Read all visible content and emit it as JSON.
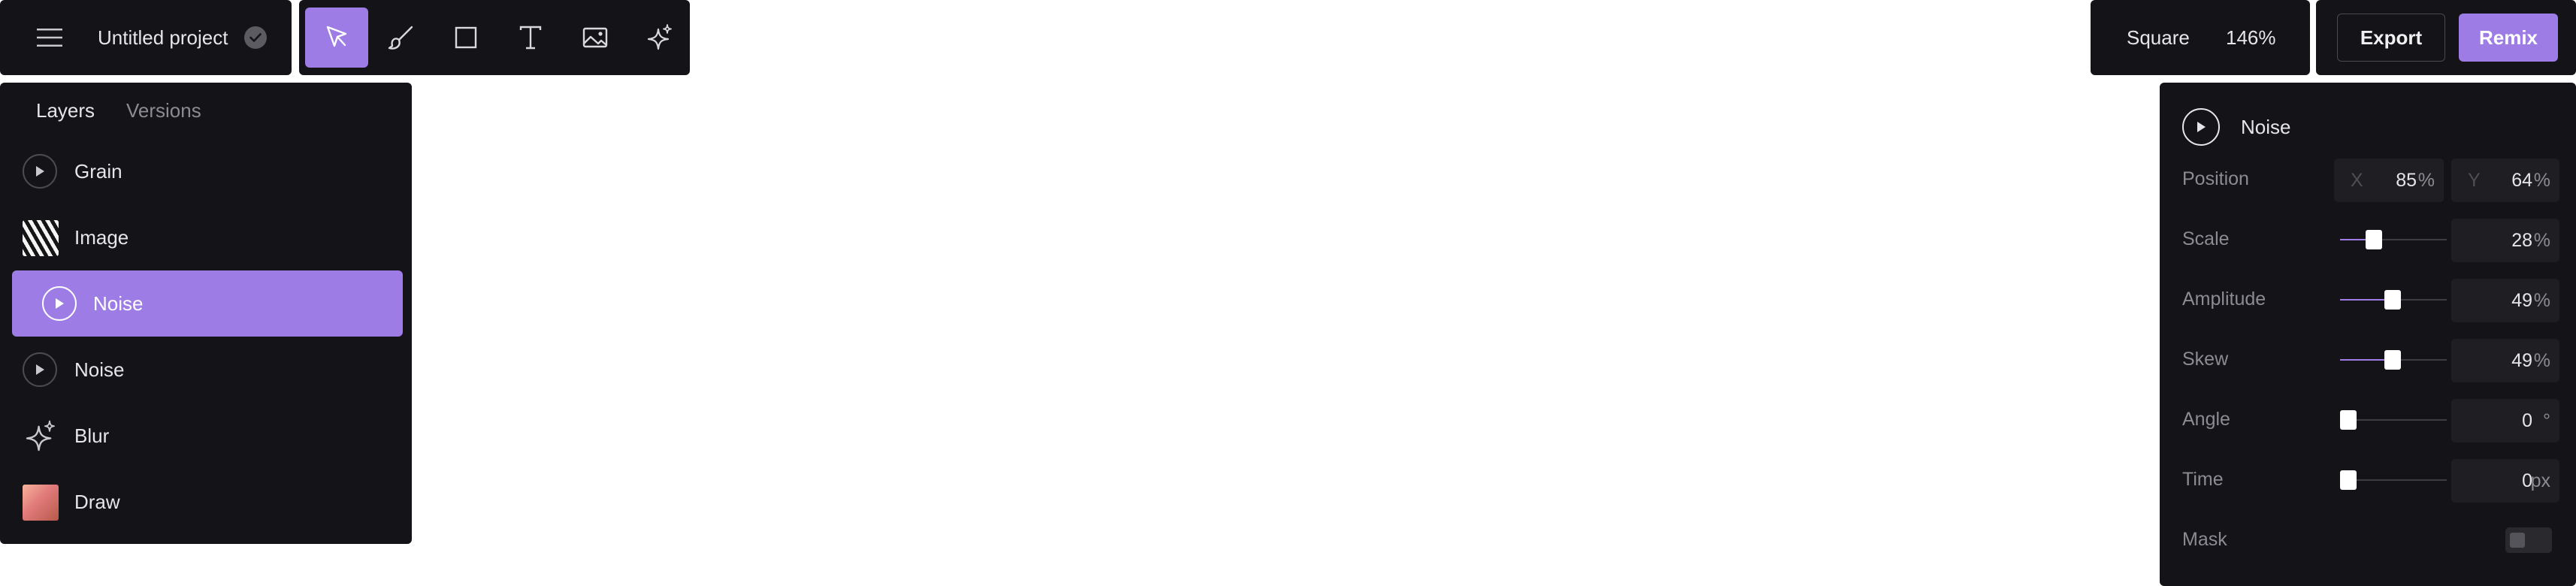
{
  "header": {
    "project_name": "Untitled project",
    "shape": "Square",
    "zoom": "146%",
    "export_label": "Export",
    "remix_label": "Remix"
  },
  "toolbar": {
    "tools": [
      {
        "name": "select",
        "icon": "cursor-arrow-icon",
        "active": true
      },
      {
        "name": "brush",
        "icon": "brush-icon",
        "active": false
      },
      {
        "name": "rectangle",
        "icon": "square-icon",
        "active": false
      },
      {
        "name": "text",
        "icon": "text-icon",
        "active": false
      },
      {
        "name": "image",
        "icon": "image-icon",
        "active": false
      },
      {
        "name": "effects",
        "icon": "sparkle-icon",
        "active": false
      }
    ]
  },
  "layers_panel": {
    "tabs": [
      {
        "label": "Layers",
        "active": true
      },
      {
        "label": "Versions",
        "active": false
      }
    ],
    "layers": [
      {
        "label": "Grain",
        "icon": "play-icon",
        "selected": false
      },
      {
        "label": "Image",
        "icon": "image-thumbnail",
        "selected": false
      },
      {
        "label": "Noise",
        "icon": "play-icon",
        "selected": true
      },
      {
        "label": "Noise",
        "icon": "play-icon",
        "selected": false
      },
      {
        "label": "Blur",
        "icon": "sparkle-icon",
        "selected": false
      },
      {
        "label": "Draw",
        "icon": "gradient-thumbnail",
        "selected": false
      }
    ]
  },
  "properties": {
    "title": "Noise",
    "position": {
      "label": "Position",
      "x_label": "X",
      "x_value": "85",
      "x_unit": "%",
      "y_label": "Y",
      "y_value": "64",
      "y_unit": "%"
    },
    "scale": {
      "label": "Scale",
      "value": "28",
      "unit": "%",
      "slider_fraction": 0.28
    },
    "amplitude": {
      "label": "Amplitude",
      "value": "49",
      "unit": "%",
      "slider_fraction": 0.49
    },
    "skew": {
      "label": "Skew",
      "value": "49",
      "unit": "%",
      "slider_fraction": 0.49
    },
    "angle": {
      "label": "Angle",
      "value": "0",
      "unit": "°",
      "slider_fraction": 0
    },
    "time": {
      "label": "Time",
      "value": "0",
      "unit": "px",
      "slider_fraction": 0
    },
    "mask": {
      "label": "Mask",
      "enabled": false
    }
  },
  "colors": {
    "accent": "#9d7ce6",
    "panel": "#141317",
    "field": "#1f1e23",
    "muted_text": "#8c8b93"
  }
}
